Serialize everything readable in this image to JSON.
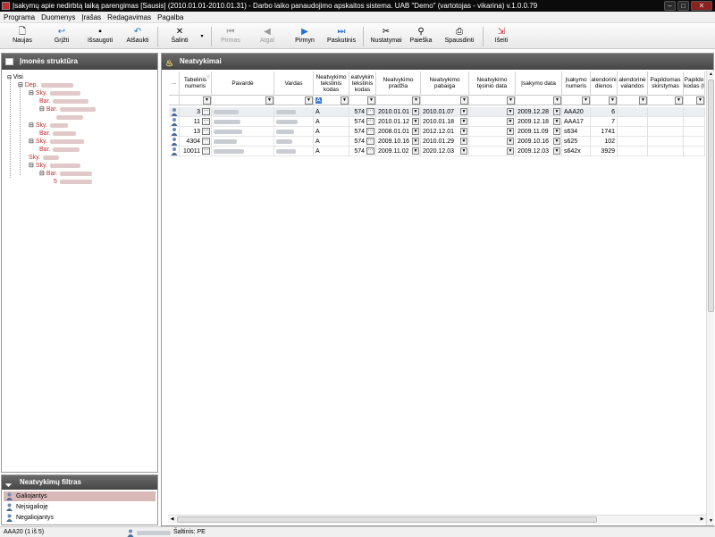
{
  "window": {
    "title": "Įsakymų apie nedirbtą laiką parengimas [Sausis] (2010.01.01-2010.01.31) - Darbo laiko panaudojimo apskaitos sistema. UAB \"Demo\" (vartotojas - vikarina) v.1.0.0.79",
    "min": "–",
    "max": "□",
    "close": "✕"
  },
  "menu": [
    "Programa",
    "Duomenys",
    "Įrašas",
    "Redagavimas",
    "Pagalba"
  ],
  "toolbar": {
    "new": "Naujas",
    "back": "Grįžti",
    "save": "Išsaugoti",
    "undo": "Atšaukti",
    "delete": "Šalinti",
    "first": "Pirmas",
    "prev": "Atgal",
    "next": "Pirmyn",
    "last": "Paskutinis",
    "settings": "Nustatymai",
    "search": "Paieška",
    "print": "Spausdinti",
    "exit": "Išeiti"
  },
  "left": {
    "title": "Įmonės struktūra",
    "tree": {
      "root": "Visi",
      "dep": "Dep.",
      "sky": "Sky.",
      "bar": "Bar.",
      "num": "5"
    }
  },
  "filter": {
    "title": "Neatvykimų filtras",
    "items": [
      "Galiojantys",
      "Neįsigalioję",
      "Negaliojantys"
    ]
  },
  "main": {
    "title": "Neatvykimai",
    "more": "···"
  },
  "columns": [
    "Tabelinis numeris",
    "Pavardė",
    "Vardas",
    "Neatvykimo tekstinis kodas",
    "eatvykim tekstinis kodas",
    "Neatvykimo pradžia",
    "Neatvykimo pabaiga",
    "Neatvykimo tęsinio data",
    "Įsakymo data",
    "Įsakymo numeris",
    "alendorini dienos",
    "alendorinė valandos",
    "Papildomas skirstymas",
    "Papildo kodas (l"
  ],
  "filter_row": {
    "code": "A"
  },
  "rows": [
    {
      "tab": "3",
      "code": "A",
      "code2": "574",
      "start": "2010.01.01",
      "end": "2010.01.07",
      "order_date": "2009.12.28",
      "order_no": "AAA20",
      "days": "6"
    },
    {
      "tab": "11",
      "code": "A",
      "code2": "574",
      "start": "2010.01.12",
      "end": "2010.01.18",
      "order_date": "2009.12.18",
      "order_no": "AAA17",
      "days": "7"
    },
    {
      "tab": "13",
      "code": "A",
      "code2": "574",
      "start": "2008.01.01",
      "end": "2012.12.01",
      "order_date": "2009.11.09",
      "order_no": "s634",
      "days": "1741"
    },
    {
      "tab": "4304",
      "code": "A",
      "code2": "574",
      "start": "2009.10.16",
      "end": "2010.01.29",
      "order_date": "2009.10.16",
      "order_no": "s625",
      "days": "102"
    },
    {
      "tab": "10011",
      "code": "A",
      "code2": "574",
      "start": "2009.11.02",
      "end": "2020.12.03",
      "order_date": "2009.12.03",
      "order_no": "s642x",
      "days": "3929"
    }
  ],
  "status": {
    "record": "AAA20 (1 iš 5)",
    "source": "Šaltinis: PE"
  },
  "colors": {
    "header": "#4f4f4f",
    "tree_text": "#c03030",
    "selected_filter": "#d9b8b8"
  }
}
